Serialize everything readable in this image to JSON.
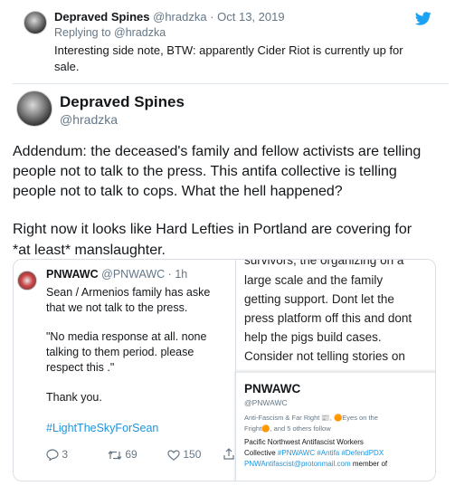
{
  "reply_tweet": {
    "display_name": "Depraved Spines",
    "handle_date": "@hradzka · Oct 13, 2019",
    "replying_to": "Replying to @hradzka",
    "text_line1": "Interesting side note, BTW: apparently Cider Riot is currently up for",
    "text_line2": "sale."
  },
  "main_tweet": {
    "display_name": "Depraved Spines",
    "handle": "@hradzka",
    "para1_line1": "Addendum: the deceased's family and fellow activists are telling",
    "para1_line2": "people not to talk to the press. This antifa collective is telling",
    "para1_line3": "people not to talk to cops. What the hell happened?",
    "para2_line1": "Right now it looks like Hard Lefties in Portland are covering for",
    "para2_line2": "*at least* manslaughter."
  },
  "embedded": {
    "left": {
      "display_name": "PNWAWC",
      "handle_time": "@PNWAWC · 1h",
      "line1": "Sean / Armenios family has aske",
      "line2": "that we not talk to the press.",
      "quote1": "\"No media response at all. none",
      "quote2": "talking to them period. please",
      "quote3": "respect this .\"",
      "thanks": "Thank you.",
      "hashtag": "#LightTheSkyForSean",
      "reply_count": "3",
      "retweet_count": "69",
      "like_count": "150"
    },
    "right": {
      "cut_line": "survivors, the organizing on a",
      "line1": "large scale and the family",
      "line2": "getting support. Dont let the",
      "line3": "press platform off this and dont",
      "line4": "help the pigs build cases.",
      "line5": "Consider not telling stories on",
      "profile_name": "PNWAWC",
      "profile_handle": "@PNWAWC",
      "followers_line1": "Anti-Fascism & Far Right 📰, 🟠Eyes on the",
      "followers_line2": "Fright🟠, and 5 others follow",
      "bio_line1": "Pacific Northwest Antifascist Workers",
      "bio_line2_prefix": "Collective",
      "bio_line2_tags": "#PNWAWC #Antifa #DefendPDX",
      "bio_line3_email": "PNWAntifascist@protonmail.com",
      "bio_line3_suffix": "member of"
    }
  },
  "colors": {
    "twitter_blue": "#1da1f2",
    "link_blue": "#1b95e0",
    "grey_text": "#657786",
    "text": "#14171a"
  },
  "icons": [
    "twitter-bird-icon",
    "reply-icon",
    "retweet-icon",
    "like-icon",
    "share-icon"
  ]
}
